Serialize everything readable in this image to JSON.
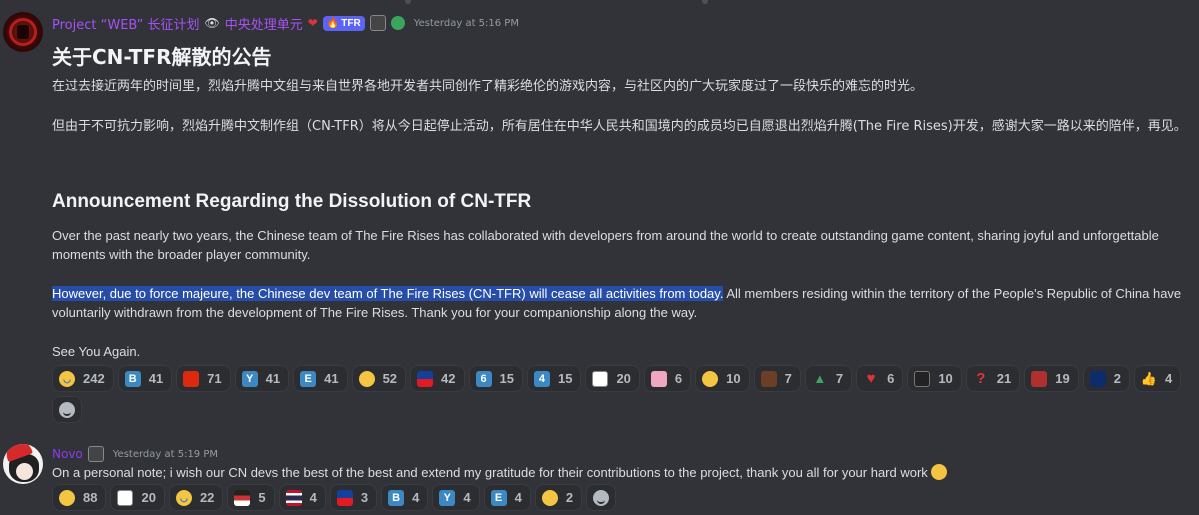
{
  "message1": {
    "author": {
      "name": "Project “WEB” 长征计划",
      "role": "中央处理单元",
      "tag": "TFR",
      "timestamp": "Yesterday at 5:16 PM"
    },
    "title_cn": "关于CN-TFR解散的公告",
    "para_cn_1": "在过去接近两年的时间里，烈焰升腾中文组与来自世界各地开发者共同创作了精彩绝伦的游戏内容，与社区内的广大玩家度过了一段快乐的难忘的时光。",
    "para_cn_2": "但由于不可抗力影响，烈焰升腾中文制作组（CN-TFR）将从今日起停止活动，所有居住在中华人民共和国境内的成员均已自愿退出烈焰升腾(The Fire Rises)开发，感谢大家一路以来的陪伴，再见。",
    "title_en": "Announcement Regarding the Dissolution of CN-TFR",
    "para_en_1": "Over the past nearly two years, the Chinese team of The Fire Rises has collaborated with developers from around the world to create outstanding game content, sharing joyful and unforgettable moments with the broader player community.",
    "para_en_2_highlight": "However, due to force majeure, the Chinese dev team of The Fire Rises (CN-TFR) will cease all activities from today.",
    "para_en_2_rest": " All members residing within the territory of the People's Republic of China have voluntarily withdrawn from the development of The Fire Rises. Thank you for your companionship along the way.",
    "para_en_3": "See You Again.",
    "reactions": [
      {
        "emoji": "sob-icon",
        "count": "242"
      },
      {
        "emoji": "letter-b-icon",
        "count": "41"
      },
      {
        "emoji": "flag-cn-icon",
        "count": "71"
      },
      {
        "emoji": "letter-y-icon",
        "count": "41"
      },
      {
        "emoji": "letter-e-icon",
        "count": "41"
      },
      {
        "emoji": "salute-face-icon",
        "count": "52"
      },
      {
        "emoji": "flag-tw-icon",
        "count": "42"
      },
      {
        "emoji": "number-6-icon",
        "count": "15"
      },
      {
        "emoji": "number-4-icon",
        "count": "15"
      },
      {
        "emoji": "white-pattern-icon",
        "count": "20"
      },
      {
        "emoji": "pink-pig-icon",
        "count": "6"
      },
      {
        "emoji": "scream-icon",
        "count": "10"
      },
      {
        "emoji": "person-portrait-icon",
        "count": "7"
      },
      {
        "emoji": "christmas-tree-icon",
        "count": "7"
      },
      {
        "emoji": "red-heart-icon",
        "count": "6"
      },
      {
        "emoji": "black-portrait-icon",
        "count": "10"
      },
      {
        "emoji": "question-mark-icon",
        "count": "21"
      },
      {
        "emoji": "red-stamp-icon",
        "count": "19"
      },
      {
        "emoji": "flag-nz-icon",
        "count": "2"
      },
      {
        "emoji": "thumbs-up-icon",
        "count": "4"
      }
    ]
  },
  "message2": {
    "author": {
      "name": "Novo",
      "timestamp": "Yesterday at 5:19 PM"
    },
    "text": "On a personal note; i wish our CN devs the best of the best and extend my gratitude for their contributions to the project, thank you all for your hard work",
    "reactions": [
      {
        "emoji": "salute-face-icon",
        "count": "88"
      },
      {
        "emoji": "white-pattern-icon",
        "count": "20"
      },
      {
        "emoji": "sob-icon",
        "count": "22"
      },
      {
        "emoji": "striped-flag-icon",
        "count": "5"
      },
      {
        "emoji": "flag-th-icon",
        "count": "4"
      },
      {
        "emoji": "flag-tw-icon",
        "count": "3"
      },
      {
        "emoji": "letter-b-icon",
        "count": "4"
      },
      {
        "emoji": "letter-y-icon",
        "count": "4"
      },
      {
        "emoji": "letter-e-icon",
        "count": "4"
      },
      {
        "emoji": "laughing-icon",
        "count": "2"
      }
    ]
  },
  "colors": {
    "background": "#313338",
    "username": "#a651f5",
    "highlight": "#264ea8",
    "reaction_bg": "#2b2d31"
  }
}
